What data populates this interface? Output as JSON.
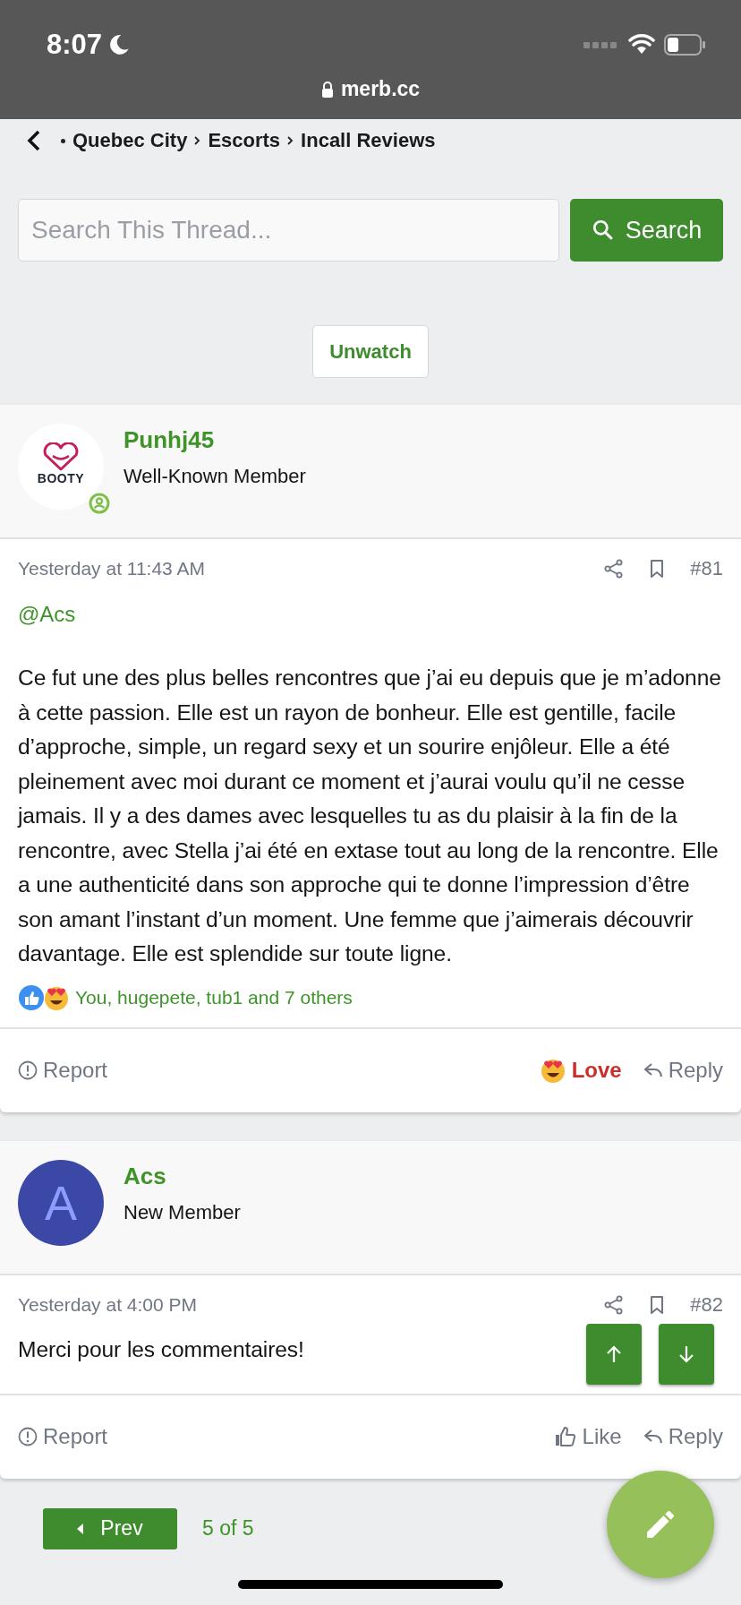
{
  "status_bar": {
    "time": "8:07",
    "do_not_disturb": true
  },
  "address_bar": {
    "url": "merb.cc",
    "secure": true
  },
  "breadcrumb": {
    "items": [
      "Quebec City",
      "Escorts",
      "Incall Reviews"
    ]
  },
  "search": {
    "placeholder": "Search This Thread...",
    "button": "Search"
  },
  "watch_button": "Unwatch",
  "posts": [
    {
      "author": {
        "name": "Punhj45",
        "title": "Well-Known Member",
        "avatar": {
          "kind": "logo",
          "text": "BOOTY"
        },
        "online": true
      },
      "date": "Yesterday at 11:43 AM",
      "number": "#81",
      "mention": "@Acs",
      "body": "Ce fut une des plus belles rencontres que j’ai eu depuis que je m’adonne à cette passion. Elle est un rayon de bonheur. Elle est gentille, facile d’approche, simple, un regard sexy et un sourire enjôleur. Elle a été pleinement avec moi durant ce moment et j’aurai voulu qu’il ne cesse jamais. Il y a des dames avec lesquelles tu as du plaisir à la fin de la rencontre, avec Stella j’ai été en extase tout au long de la rencontre. Elle a une authenticité dans son approche qui te donne l’impression d’être son amant l’instant d’un moment. Une femme que j’aimerais découvrir davantage. Elle est splendide sur toute ligne.",
      "reactions": "You, hugepete, tub1 and 7 others",
      "scroll_buttons": false,
      "actions": [
        {
          "kind": "report",
          "label": "Report"
        },
        {
          "kind": "react",
          "label": "Love",
          "selected": true
        },
        {
          "kind": "reply",
          "label": "Reply"
        }
      ]
    },
    {
      "author": {
        "name": "Acs",
        "title": "New Member",
        "avatar": {
          "kind": "letter",
          "text": "A",
          "color": "#3c48a6"
        }
      },
      "date": "Yesterday at 4:00 PM",
      "number": "#82",
      "body": "Merci pour les commentaires!",
      "scroll_buttons": true,
      "actions": [
        {
          "kind": "report",
          "label": "Report"
        },
        {
          "kind": "react",
          "label": "Like",
          "selected": false
        },
        {
          "kind": "reply",
          "label": "Reply"
        }
      ]
    }
  ],
  "pagination": {
    "prev": "Prev",
    "page": "5 of 5"
  }
}
